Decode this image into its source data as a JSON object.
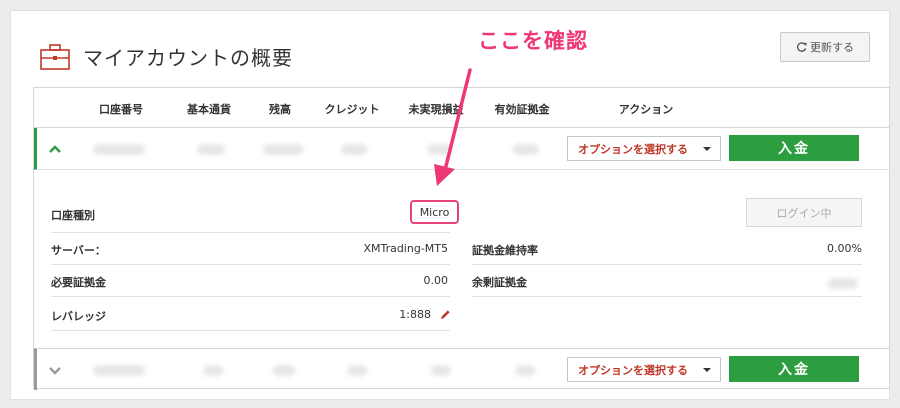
{
  "header": {
    "title": "マイアカウントの概要",
    "refresh_label": "更新する",
    "icon": "briefcase-icon",
    "accent_color": "#c0392b"
  },
  "annotation": {
    "text": "ここを確認",
    "color": "#ee3776"
  },
  "table": {
    "columns": [
      "口座番号",
      "基本通貨",
      "残高",
      "クレジット",
      "未実現損益",
      "有効証拠金",
      "アクション"
    ],
    "rows": [
      {
        "expanded": true,
        "select_label": "オプションを選択する",
        "deposit_label": "入金",
        "row_accent": "#2e9b46"
      },
      {
        "expanded": false,
        "select_label": "オプションを選択する",
        "deposit_label": "入金",
        "row_accent": "#9a9a9a"
      }
    ],
    "details": {
      "account_type_label": "口座種別",
      "account_type_value": "Micro",
      "login_label": "ログイン中",
      "server_label": "サーバー：",
      "server_value": "XMTrading-MT5",
      "margin_level_label": "証拠金維持率",
      "margin_level_value": "0.00%",
      "required_margin_label": "必要証拠金",
      "required_margin_value": "0.00",
      "free_margin_label": "余剰証拠金",
      "leverage_label": "レバレッジ",
      "leverage_value": "1:888"
    }
  },
  "colors": {
    "deposit_button": "#2c9e3f",
    "highlight_box": "#e6427e"
  }
}
